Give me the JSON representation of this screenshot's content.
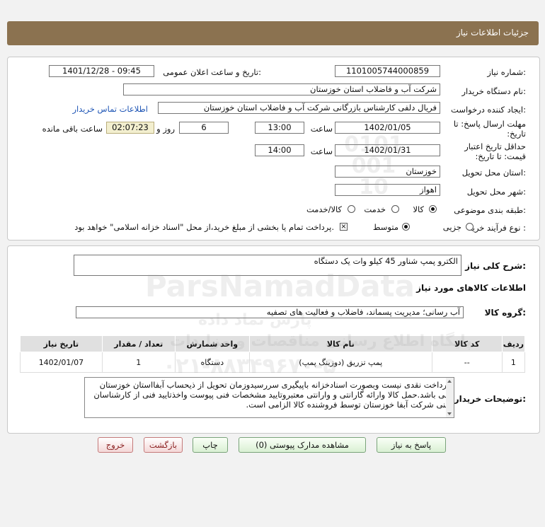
{
  "header": {
    "title": "جزئیات اطلاعات نیاز"
  },
  "details": {
    "need_number_label": "شماره نیاز:",
    "need_number": "1101005744000859",
    "announce_label": "تاریخ و ساعت اعلان عمومی:",
    "announce_value": "1401/12/28 - 09:45",
    "buyer_label": "نام دستگاه خریدار:",
    "buyer_value": "شرکت آب و فاضلاب استان خوزستان",
    "creator_label": "ایجاد کننده درخواست:",
    "creator_value": "فریال دلفی کارشناس بازرگانی شرکت آب و فاضلاب استان خوزستان",
    "contact_link": "اطلاعات تماس خریدار",
    "reply_label": "مهلت ارسال پاسخ: تا تاریخ:",
    "reply_date": "1402/01/05",
    "time_label": "ساعت",
    "reply_time": "13:00",
    "days_value": "6",
    "days_label": "روز و",
    "remaining_value": "02:07:23",
    "remaining_label": "ساعت باقی مانده",
    "validity_label": "حداقل تاریخ اعتبار قیمت: تا تاریخ:",
    "validity_date": "1402/01/31",
    "validity_time": "14:00",
    "province_label": "استان محل تحویل:",
    "province_value": "خوزستان",
    "city_label": "شهر محل تحویل:",
    "city_value": "اهواز",
    "category_label": "طبقه بندی موضوعی:",
    "category_options": [
      "کالا",
      "خدمت",
      "کالا/خدمت"
    ],
    "category_selected": "کالا",
    "process_label": "نوع فرآیند خرید :",
    "process_options": [
      "جزیی",
      "متوسط"
    ],
    "process_selected": "متوسط",
    "treasury_text": "پرداخت تمام یا بخشی از مبلغ خرید،از محل \"اسناد خزانه اسلامی\" خواهد بود."
  },
  "summary": {
    "label": "شرح کلی نیاز:",
    "value": "الکترو پمپ شناور 45 کیلو وات یک دستگاه",
    "items_title": "اطلاعات کالاهای مورد نیاز",
    "group_label": "گروه کالا:",
    "group_value": "آب رسانی؛ مدیریت پسماند، فاضلاب و فعالیت های تصفیه"
  },
  "table": {
    "headers": [
      "ردیف",
      "کد کالا",
      "نام کالا",
      "واحد شمارش",
      "تعداد / مقدار",
      "تاریخ نیاز"
    ],
    "rows": [
      [
        "1",
        "--",
        "پمپ تزریق (دوزینگ پمپ)",
        "دستگاه",
        "1",
        "1402/01/07"
      ]
    ]
  },
  "notes": {
    "label": "توضیحات خریدار:",
    "text": "پرداخت نقدی نیست وبصورت اسنادخزانه باپیگیری سررسیدوزمان تحویل از ذیحساب آبفااستان خوزستان می باشد.حمل کالا وارائه گارانتی و وارانتی معتبروتایید مشخصات فنی پیوست واخذتایید فنی از کارشناسان فنی شرکت آبفا خوزستان توسط فروشنده کالا الزامی است."
  },
  "buttons": {
    "reply": "پاسخ به نیاز",
    "attachments": "مشاهده مدارک پیوستی (0)",
    "print": "چاپ",
    "back": "بازگشت",
    "exit": "خروج"
  },
  "watermark": {
    "brand": "ParsNamadData",
    "brand_fa": "پارس نماد داده",
    "portal": "پایگاه اطلاع رسانی مناقصات و مزایدات",
    "phone": "۰۲۱-۸۸۳۴۹۶۷۰-۵",
    "badge": "0101 001 10"
  },
  "colors": {
    "header_bg": "#8b7250",
    "link": "#1e55b5",
    "remaining_bg": "#f3efcf"
  }
}
